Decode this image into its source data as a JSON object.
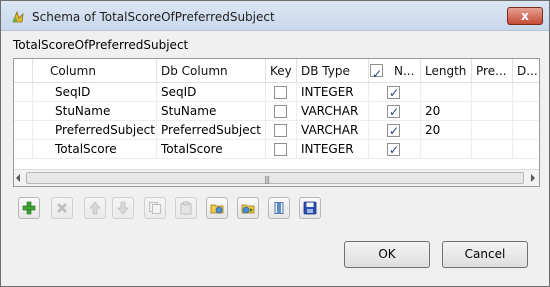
{
  "window": {
    "title": "Schema of TotalScoreOfPreferredSubject",
    "close_label": "x",
    "colors": {
      "titlebar": "#c9d8ec",
      "close": "#c54d38"
    }
  },
  "schema_label": "TotalScoreOfPreferredSubject",
  "table": {
    "headers": {
      "column": "Column",
      "db_column": "Db Column",
      "key": "Key",
      "db_type": "DB Type",
      "nullable": "N...",
      "length": "Length",
      "precision": "Pre...",
      "default": "D..."
    },
    "nullable_header_checked": true,
    "rows": [
      {
        "column": "SeqID",
        "db_column": "SeqID",
        "key": false,
        "db_type": "INTEGER",
        "nullable": true,
        "length": ""
      },
      {
        "column": "StuName",
        "db_column": "StuName",
        "key": false,
        "db_type": "VARCHAR",
        "nullable": true,
        "length": "20"
      },
      {
        "column": "PreferredSubject",
        "db_column": "PreferredSubject",
        "key": false,
        "db_type": "VARCHAR",
        "nullable": true,
        "length": "20"
      },
      {
        "column": "TotalScore",
        "db_column": "TotalScore",
        "key": false,
        "db_type": "INTEGER",
        "nullable": true,
        "length": ""
      }
    ],
    "scroll_grip": "|||"
  },
  "toolbar": {
    "buttons": [
      {
        "name": "add-button",
        "icon": "plus-icon",
        "enabled": true
      },
      {
        "name": "remove-button",
        "icon": "remove-icon",
        "enabled": false
      },
      {
        "name": "move-up-button",
        "icon": "arrow-up-icon",
        "enabled": false
      },
      {
        "name": "move-down-button",
        "icon": "arrow-down-icon",
        "enabled": false
      },
      {
        "name": "copy-button",
        "icon": "copy-icon",
        "enabled": false
      },
      {
        "name": "paste-button",
        "icon": "paste-icon",
        "enabled": false
      },
      {
        "name": "import-schema-button",
        "icon": "folder-import-icon",
        "enabled": true
      },
      {
        "name": "export-schema-button",
        "icon": "folder-export-icon",
        "enabled": true
      },
      {
        "name": "reset-button",
        "icon": "column-icon",
        "enabled": true
      },
      {
        "name": "save-button",
        "icon": "floppy-disk-icon",
        "enabled": true
      }
    ]
  },
  "footer": {
    "ok_label": "OK",
    "cancel_label": "Cancel"
  }
}
